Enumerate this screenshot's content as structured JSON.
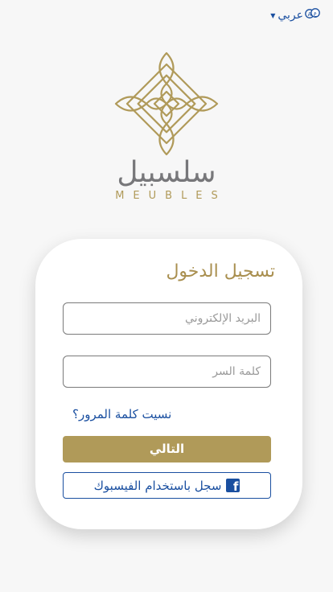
{
  "language_switch": {
    "label": "عربي",
    "icon": "translate-icon"
  },
  "brand": {
    "arabic": "سلسبيل",
    "english": "MEUBLES",
    "color": "#b09a59"
  },
  "login": {
    "title": "تسجيل الدخول",
    "email_placeholder": "البريد الإلكتروني",
    "email_value": "",
    "password_placeholder": "كلمة السر",
    "password_value": "",
    "forgot_label": "نسيت كلمة المرور؟",
    "next_label": "التالي",
    "facebook_label": "سجل باستخدام الفيسبوك",
    "facebook_icon": "facebook-icon"
  },
  "colors": {
    "gold": "#b09a59",
    "link_blue": "#1a4fa0",
    "background": "#f7f7f7"
  }
}
